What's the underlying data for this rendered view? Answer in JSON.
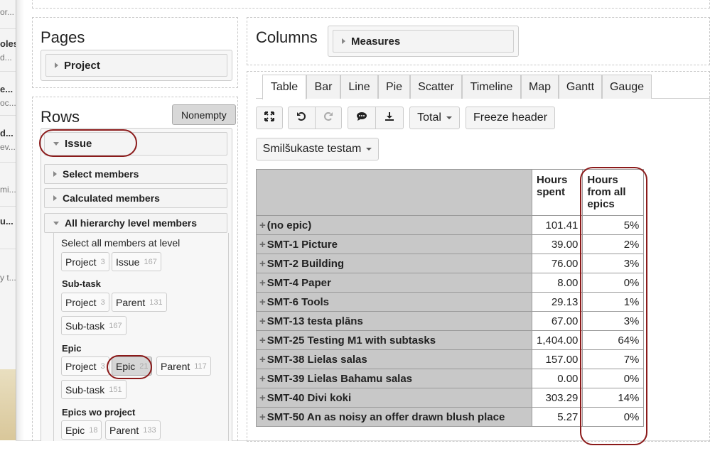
{
  "pages": {
    "title": "Pages",
    "dimension": "Project"
  },
  "columns": {
    "title": "Columns",
    "dimension": "Measures"
  },
  "rows": {
    "title": "Rows",
    "nonempty": "Nonempty",
    "dimension": "Issue",
    "select_members": "Select members",
    "calculated_members": "Calculated members",
    "all_hierarchy": "All hierarchy level members",
    "select_all_text": "Select all members at level",
    "level_chips": [
      {
        "label": "Project",
        "count": "3"
      },
      {
        "label": "Issue",
        "count": "167"
      }
    ],
    "subtask": {
      "title": "Sub-task",
      "chips": [
        {
          "label": "Project",
          "count": "3"
        },
        {
          "label": "Parent",
          "count": "131"
        },
        {
          "label": "Sub-task",
          "count": "167"
        }
      ]
    },
    "epic": {
      "title": "Epic",
      "chips": [
        {
          "label": "Project",
          "count": "3"
        },
        {
          "label": "Epic",
          "count": "21"
        },
        {
          "label": "Parent",
          "count": "117"
        },
        {
          "label": "Sub-task",
          "count": "151"
        }
      ]
    },
    "epics_wo": {
      "title": "Epics wo project",
      "chips": [
        {
          "label": "Epic",
          "count": "18"
        },
        {
          "label": "Parent",
          "count": "133"
        }
      ]
    }
  },
  "tabs": [
    "Table",
    "Bar",
    "Line",
    "Pie",
    "Scatter",
    "Timeline",
    "Map",
    "Gantt",
    "Gauge"
  ],
  "toolbar": {
    "total": "Total",
    "freeze": "Freeze header",
    "dataset": "Smilšukaste testam"
  },
  "icons": {
    "expand": "expand-icon",
    "undo": "undo-icon",
    "redo": "redo-icon",
    "comment": "comment-icon",
    "download": "download-icon"
  },
  "table": {
    "headers": [
      "Hours spent",
      "Hours from all epics"
    ],
    "rows": [
      {
        "label": "(no epic)",
        "hours": "101.41",
        "pct": "5%"
      },
      {
        "label": "SMT-1 Picture",
        "hours": "39.00",
        "pct": "2%"
      },
      {
        "label": "SMT-2 Building",
        "hours": "76.00",
        "pct": "3%"
      },
      {
        "label": "SMT-4 Paper",
        "hours": "8.00",
        "pct": "0%"
      },
      {
        "label": "SMT-6 Tools",
        "hours": "29.13",
        "pct": "1%"
      },
      {
        "label": "SMT-13 testa plāns",
        "hours": "67.00",
        "pct": "3%"
      },
      {
        "label": "SMT-25 Testing M1 with subtasks",
        "hours": "1,404.00",
        "pct": "64%"
      },
      {
        "label": "SMT-38 Lielas salas",
        "hours": "157.00",
        "pct": "7%"
      },
      {
        "label": "SMT-39 Lielas Bahamu salas",
        "hours": "0.00",
        "pct": "0%"
      },
      {
        "label": "SMT-40 Divi koki",
        "hours": "303.29",
        "pct": "14%"
      },
      {
        "label": "SMT-50 An as noisy an offer drawn blush place",
        "hours": "5.27",
        "pct": "0%"
      }
    ]
  },
  "left_strip": {
    "fragments": [
      "or...",
      "oles",
      "d...",
      "e...",
      "oc...",
      "d...",
      "ev...",
      "mi...",
      "u...",
      "y t..."
    ]
  },
  "annotation_color": "#8b1a1a"
}
